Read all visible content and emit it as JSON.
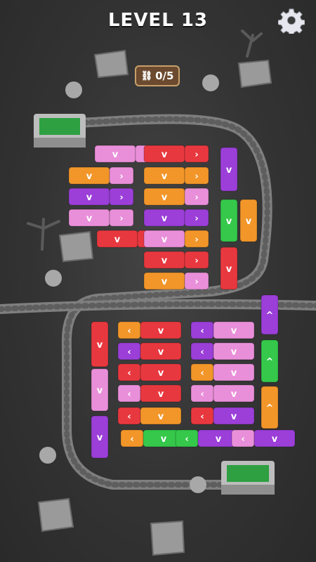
{
  "header": {
    "title": "LEVEL 13"
  },
  "counter": {
    "label": "0/5"
  },
  "colors": {
    "pink": "#e98fd9",
    "red": "#e8383f",
    "purple": "#9b3fd8",
    "orange": "#f2962a",
    "green": "#35c84a",
    "track": "#8a8a8a",
    "building": "#bdbdbd"
  },
  "grid": {
    "rows_top": [
      [
        "pink",
        "red",
        "purple"
      ],
      [
        "orange",
        "orange"
      ],
      [
        "purple",
        "pink"
      ],
      [
        "pink",
        "orange"
      ],
      [
        "red",
        "purple"
      ],
      [
        "red"
      ],
      [
        "orange"
      ]
    ]
  }
}
